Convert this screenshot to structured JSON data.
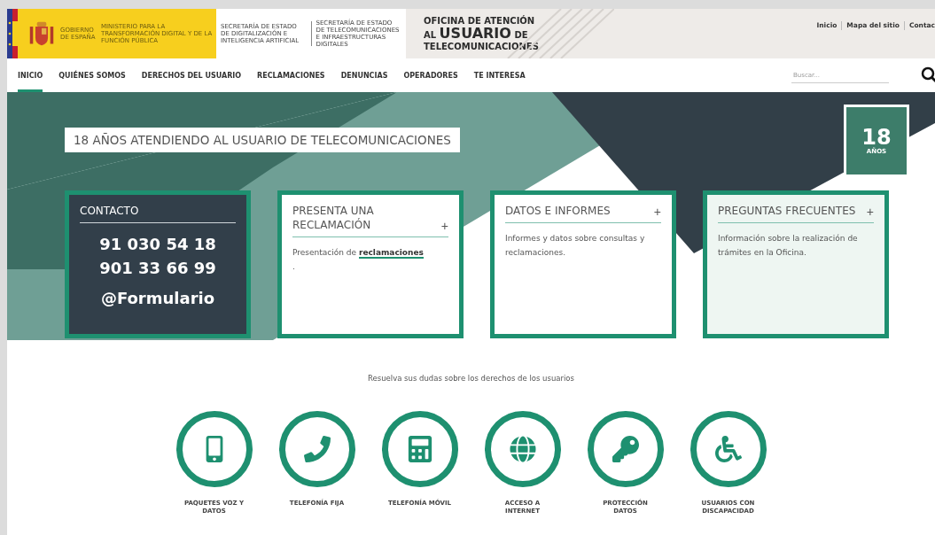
{
  "header": {
    "government": "GOBIERNO DE ESPAÑA",
    "ministry": "MINISTERIO PARA LA TRANSFORMACIÓN DIGITAL Y DE LA FUNCIÓN PÚBLICA",
    "secretariats": [
      "SECRETARÍA DE ESTADO DE DIGITALIZACIÓN E INTELIGENCIA ARTIFICIAL",
      "SECRETARÍA DE ESTADO DE TELECOMUNICACIONES E INFRAESTRUCTURAS DIGITALES"
    ],
    "site_title": {
      "line_1": "OFICINA DE ATENCIÓN",
      "line_2_small": "AL",
      "line_2_big": "USUARIO",
      "line_2_end": "DE",
      "line_3": "TELECOMUNICACIONES"
    },
    "top_links": [
      "Inicio",
      "Mapa del sitio",
      "Contac"
    ]
  },
  "nav": {
    "items": [
      {
        "label": "INICIO",
        "selected": true
      },
      {
        "label": "QUIÉNES SOMOS",
        "selected": false
      },
      {
        "label": "DERECHOS DEL USUARIO",
        "selected": false
      },
      {
        "label": "RECLAMACIONES",
        "selected": false
      },
      {
        "label": "DENUNCIAS",
        "selected": false
      },
      {
        "label": "OPERADORES",
        "selected": false
      },
      {
        "label": "TE INTERESA",
        "selected": false
      }
    ],
    "search": {
      "placeholder": "Buscar..."
    }
  },
  "hero": {
    "headline": "18 AÑOS ATENDIENDO AL USUARIO DE TELECOMUNICACIONES",
    "badge": {
      "number": "18",
      "caption": "AÑOS"
    }
  },
  "cards": [
    {
      "kind": "contact",
      "title": "CONTACTO",
      "phones": [
        "91 030 54 18",
        "901 33 66 99"
      ],
      "link": "@Formulario"
    },
    {
      "kind": "info",
      "title": "PRESENTA UNA RECLAMACIÓN",
      "toggle": "+",
      "text": "Presentación de",
      "link": "reclamaciones",
      "after": "."
    },
    {
      "kind": "info",
      "title": "DATOS E INFORMES",
      "toggle": "+",
      "text": "Informes y datos sobre consultas y reclamaciones."
    },
    {
      "kind": "info",
      "title": "PREGUNTAS FRECUENTES",
      "toggle": "+",
      "text": "Información sobre la realización de trámites en la Oficina.",
      "tinted": true
    }
  ],
  "rights": {
    "intro": "Resuelva sus dudas sobre los derechos de los usuarios",
    "items": [
      {
        "label": "PAQUETES VOZ Y DATOS"
      },
      {
        "label": "TELEFONÍA FIJA"
      },
      {
        "label": "TELEFONÍA MÓVIL"
      },
      {
        "label": "ACCESO A INTERNET"
      },
      {
        "label": "PROTECCIÓN DATOS"
      },
      {
        "label": "USUARIOS CON DISCAPACIDAD"
      }
    ]
  }
}
